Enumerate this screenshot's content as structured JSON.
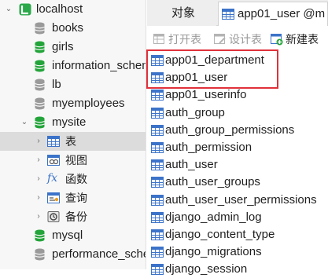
{
  "tree": {
    "connection": {
      "label": "localhost",
      "icon": "connection-icon"
    },
    "databases": [
      {
        "label": "books",
        "expanded": false
      },
      {
        "label": "girls",
        "expanded": false
      },
      {
        "label": "information_schema",
        "expanded": false
      },
      {
        "label": "lb",
        "expanded": false
      },
      {
        "label": "myemployees",
        "expanded": false
      },
      {
        "label": "mysite",
        "expanded": true
      },
      {
        "label": "mysql",
        "expanded": false
      },
      {
        "label": "performance_schema",
        "expanded": false
      }
    ],
    "mysite_children": [
      {
        "label": "表",
        "icon": "table-icon",
        "selected": true
      },
      {
        "label": "视图",
        "icon": "view-icon"
      },
      {
        "label": "函数",
        "icon": "function-icon"
      },
      {
        "label": "查询",
        "icon": "query-icon"
      },
      {
        "label": "备份",
        "icon": "backup-icon"
      }
    ]
  },
  "tabs": {
    "objects": "对象",
    "table_tab": "app01_user @m"
  },
  "toolbar": {
    "open_table": "打开表",
    "design_table": "设计表",
    "new_table": "新建表"
  },
  "tables": [
    "app01_department",
    "app01_user",
    "app01_userinfo",
    "auth_group",
    "auth_group_permissions",
    "auth_permission",
    "auth_user",
    "auth_user_groups",
    "auth_user_user_permissions",
    "django_admin_log",
    "django_content_type",
    "django_migrations",
    "django_session"
  ],
  "colors": {
    "db_green": "#23a43a",
    "table_blue": "#3b73c9",
    "highlight_red": "#e0313a",
    "selected_bg": "#dcdcdc"
  }
}
